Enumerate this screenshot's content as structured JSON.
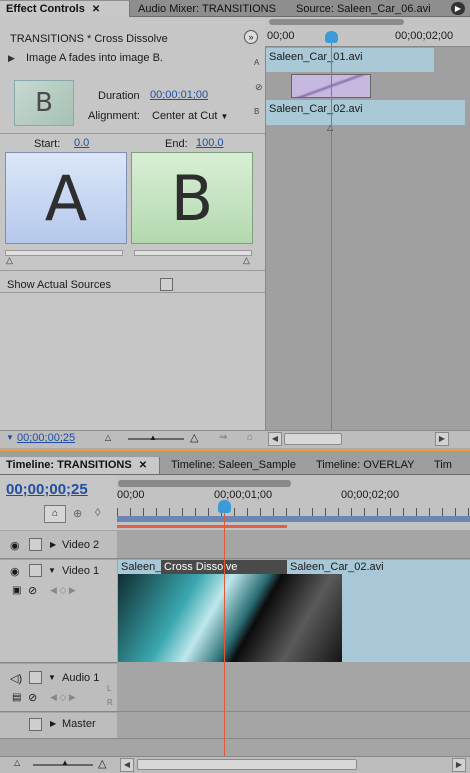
{
  "effect_controls": {
    "tabs": [
      {
        "label": "Effect Controls",
        "close": "✕"
      },
      {
        "label": "Audio Mixer: TRANSITIONS"
      },
      {
        "label": "Source: Saleen_Car_06.avi"
      }
    ],
    "transition_title": "TRANSITIONS * Cross Dissolve",
    "description": "Image A fades into image B.",
    "duration_label": "Duration",
    "duration_value": "00;00;01;00",
    "alignment_label": "Alignment:",
    "alignment_value": "Center at Cut",
    "start_label": "Start:",
    "start_value": "0.0",
    "end_label": "End:",
    "end_value": "100.0",
    "preview_a": "A",
    "preview_b": "B",
    "thumb_glyph": "B",
    "show_actual_sources": "Show Actual Sources",
    "current_time": "00;00;00;25",
    "mini_timeline": {
      "ruler_start": "00;00",
      "ruler_end": "00;00;02;00",
      "track_a_label": "A",
      "track_b_label": "B",
      "clip_a": "Saleen_Car_01.avi",
      "clip_b": "Saleen_Car_02.avi"
    }
  },
  "timeline": {
    "tabs": [
      {
        "label": "Timeline: TRANSITIONS",
        "close": "✕"
      },
      {
        "label": "Timeline: Saleen_Sample"
      },
      {
        "label": "Timeline: OVERLAY"
      },
      {
        "label": "Tim"
      }
    ],
    "timecode": "00;00;00;25",
    "ruler": [
      "00;00",
      "00;00;01;00",
      "00;00;02;00"
    ],
    "tracks": {
      "video2": "Video 2",
      "video1": "Video 1",
      "audio1": "Audio 1",
      "master": "Master"
    },
    "clips": {
      "clip1": "Saleen_",
      "transition": "Cross Dissolve",
      "clip2": "Saleen_Car_02.avi"
    },
    "audio_side_letters": [
      "L",
      "R"
    ]
  },
  "colors": {
    "accent_orange": "#f0a030",
    "playhead": "#e05a3a",
    "timecode_blue": "#1f4fa3",
    "clip_blue": "#a8c8d8"
  }
}
